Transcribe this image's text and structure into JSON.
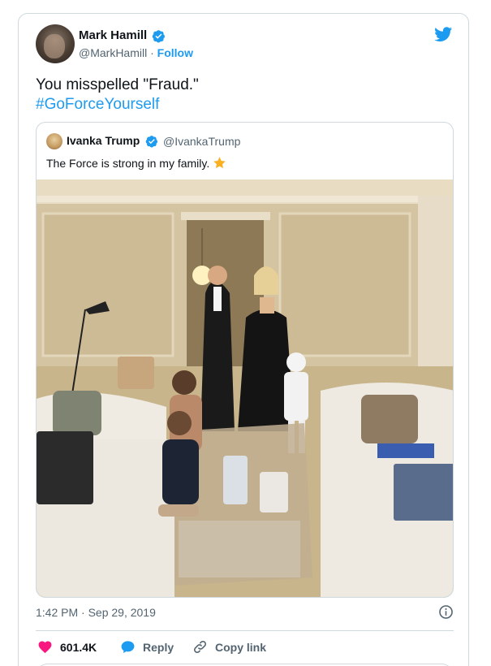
{
  "tweet": {
    "author_name": "Mark Hamill",
    "handle": "@MarkHamill",
    "separator": " · ",
    "follow_label": "Follow",
    "text": "You misspelled \"Fraud.\"",
    "hashtag": "#GoForceYourself",
    "timestamp": "1:42 PM · Sep 29, 2019"
  },
  "quoted_tweet": {
    "author_name": "Ivanka Trump",
    "handle": "@IvankaTrump",
    "text": "The Force is strong in my family."
  },
  "actions": {
    "like_count": "601.4K",
    "reply_label": "Reply",
    "copy_label": "Copy link"
  },
  "colors": {
    "accent": "#1d9bf0",
    "like": "#f91880",
    "text_secondary": "#536471",
    "border": "#cfd9de"
  },
  "icons": [
    "verified-badge-icon",
    "twitter-bird-icon",
    "star-emoji-icon",
    "info-icon",
    "heart-icon",
    "reply-bubble-icon",
    "link-icon"
  ]
}
